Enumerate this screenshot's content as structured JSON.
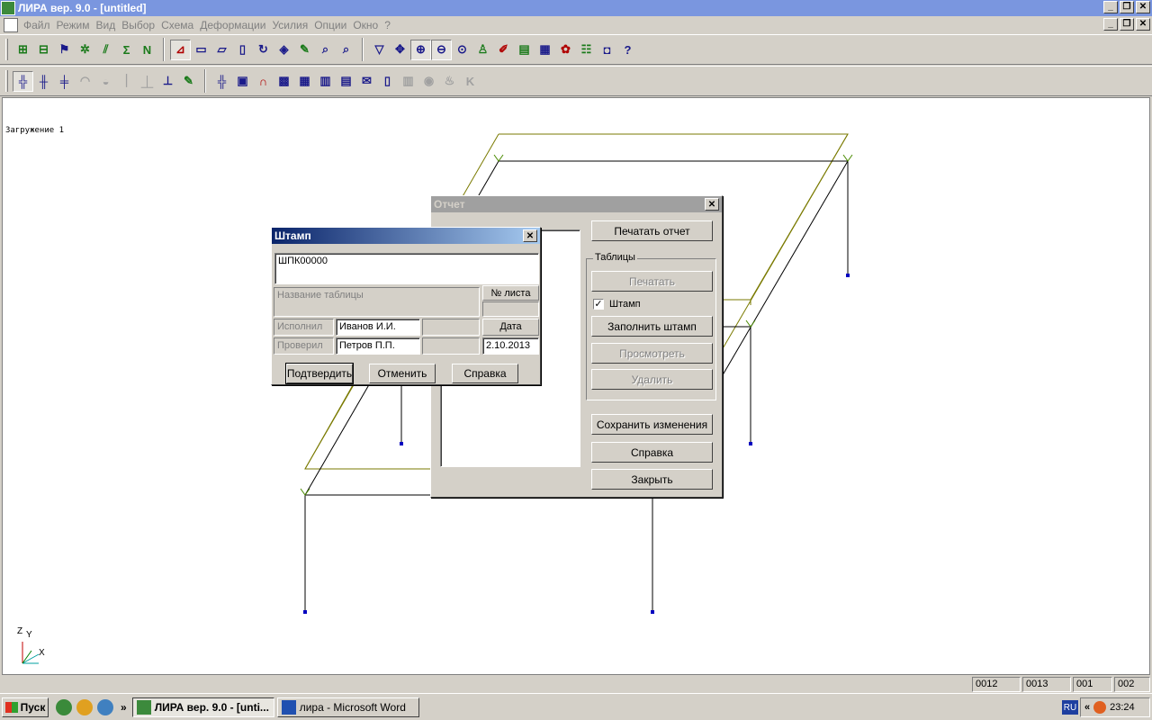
{
  "window": {
    "title": "ЛИРА  вер. 9.0 - [untitled]"
  },
  "menu": [
    "Файл",
    "Режим",
    "Вид",
    "Выбор",
    "Схема",
    "Деформации",
    "Усилия",
    "Опции",
    "Окно",
    "?"
  ],
  "workspace": {
    "load_label": "Загружение  1"
  },
  "axes": {
    "z": "Z",
    "y": "Y",
    "x": "X"
  },
  "report_dialog": {
    "title": "Отчет",
    "print_report": "Печатать отчет",
    "tables_group": "Таблицы",
    "print": "Печатать",
    "stamp_checkbox": "Штамп",
    "stamp_checked": true,
    "fill_stamp": "Заполнить штамп",
    "view": "Просмотреть",
    "delete": "Удалить",
    "save_changes": "Сохранить изменения",
    "help": "Справка",
    "close": "Закрыть"
  },
  "stamp_dialog": {
    "title": "Штамп",
    "code": "ШПК00000",
    "table_name_label": "Название таблицы",
    "sheet_no_label": "№ листа",
    "sheet_no_value": "",
    "performed_label": "Исполнил",
    "performed_value": "Иванов И.И.",
    "date_label": "Дата",
    "checked_label": "Проверил",
    "checked_value": "Петров П.П.",
    "date_value": "2.10.2013",
    "confirm": "Подтвердить",
    "cancel": "Отменить",
    "help": "Справка"
  },
  "status": [
    "0012",
    "0013",
    "001",
    "002"
  ],
  "taskbar": {
    "start": "Пуск",
    "more": "»",
    "tasks": [
      {
        "label": "ЛИРА  вер. 9.0 - [unti...",
        "active": true
      },
      {
        "label": "лира - Microsoft Word",
        "active": false
      }
    ],
    "lang": "RU",
    "tray_expand": "«",
    "clock": "23:24"
  },
  "colors": {
    "frame_olive": "#7a7a00",
    "frame_black": "#000000",
    "support": "#0000c0",
    "title_active": "#0a246a"
  }
}
